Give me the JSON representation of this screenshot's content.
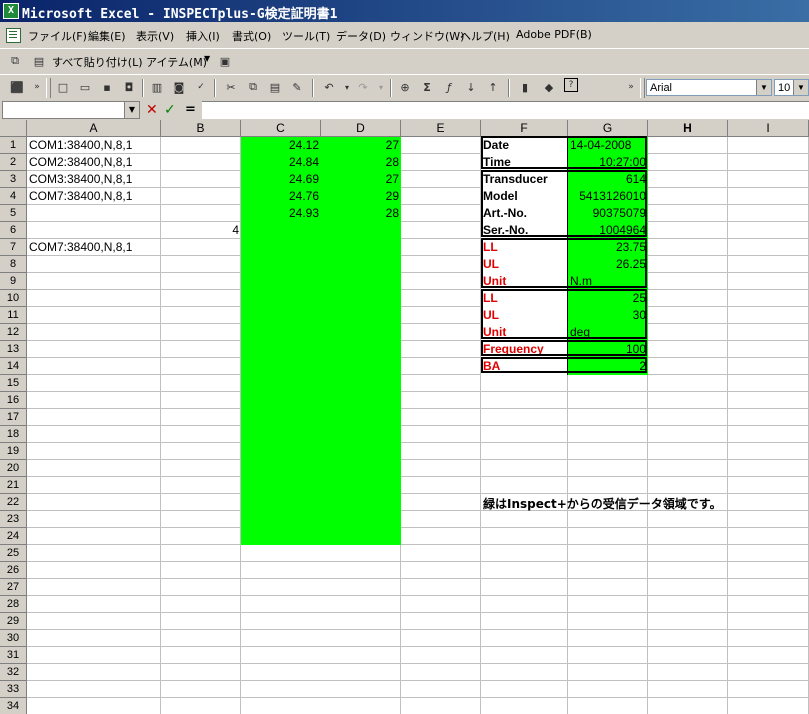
{
  "window": {
    "title": "Microsoft Excel - INSPECTplus-G検定証明書1"
  },
  "menu": [
    "ファイル(F)",
    "編集(E)",
    "表示(V)",
    "挿入(I)",
    "書式(O)",
    "ツール(T)",
    "データ(D)",
    "ウィンドウ(W)",
    "ヘルプ(H)",
    "Adobe PDF(B)"
  ],
  "toolbar2": {
    "paste_all": "すべて貼り付け(L)",
    "items": "アイテム(M)"
  },
  "toolbar3": {
    "font": "Arial",
    "size": "10"
  },
  "formula_bar": {
    "name_box": "",
    "fx_label": "="
  },
  "columns": [
    "A",
    "B",
    "C",
    "D",
    "E",
    "F",
    "G",
    "H",
    "I"
  ],
  "active_column": "H",
  "rows": [
    "1",
    "2",
    "3",
    "4",
    "5",
    "6",
    "7",
    "8",
    "9",
    "10",
    "11",
    "12",
    "13",
    "14",
    "15",
    "16",
    "17",
    "18",
    "19",
    "20",
    "21",
    "22",
    "23",
    "24",
    "25",
    "26",
    "27",
    "28",
    "29",
    "30",
    "31",
    "32",
    "33",
    "34"
  ],
  "colA": [
    "COM1:38400,N,8,1",
    "COM2:38400,N,8,1",
    "COM3:38400,N,8,1",
    "COM7:38400,N,8,1",
    "",
    "4",
    "COM7:38400,N,8,1"
  ],
  "colC": [
    "24.12",
    "24.84",
    "24.69",
    "24.76",
    "24.93"
  ],
  "colD": [
    "27",
    "28",
    "27",
    "29",
    "28"
  ],
  "info": [
    {
      "label": "Date",
      "value": "14-04-2008",
      "red": false,
      "align": "left"
    },
    {
      "label": "Time",
      "value": "10:27:00",
      "red": false,
      "align": "right"
    },
    {
      "label": "Transducer",
      "value": "614",
      "red": false,
      "align": "right"
    },
    {
      "label": "Model",
      "value": "5413126010",
      "red": false,
      "align": "right"
    },
    {
      "label": "Art.-No.",
      "value": "90375079",
      "red": false,
      "align": "right"
    },
    {
      "label": "Ser.-No.",
      "value": "1004964",
      "red": false,
      "align": "right"
    },
    {
      "label": "LL",
      "value": "23.75",
      "red": true,
      "align": "right"
    },
    {
      "label": "UL",
      "value": "26.25",
      "red": true,
      "align": "right"
    },
    {
      "label": "Unit",
      "value": "N.m",
      "red": true,
      "align": "left"
    },
    {
      "label": "LL",
      "value": "25",
      "red": true,
      "align": "right"
    },
    {
      "label": "UL",
      "value": "30",
      "red": true,
      "align": "right"
    },
    {
      "label": "Unit",
      "value": "deg",
      "red": true,
      "align": "left"
    },
    {
      "label": "Frequency",
      "value": "100",
      "red": true,
      "align": "right"
    },
    {
      "label": "BA",
      "value": "2",
      "red": true,
      "align": "right"
    }
  ],
  "note": "緑はInspect+からの受信データ領域です。",
  "colors": {
    "green": "#00ff00",
    "red_label": "#e00000",
    "title_bar": "#0a246a"
  }
}
